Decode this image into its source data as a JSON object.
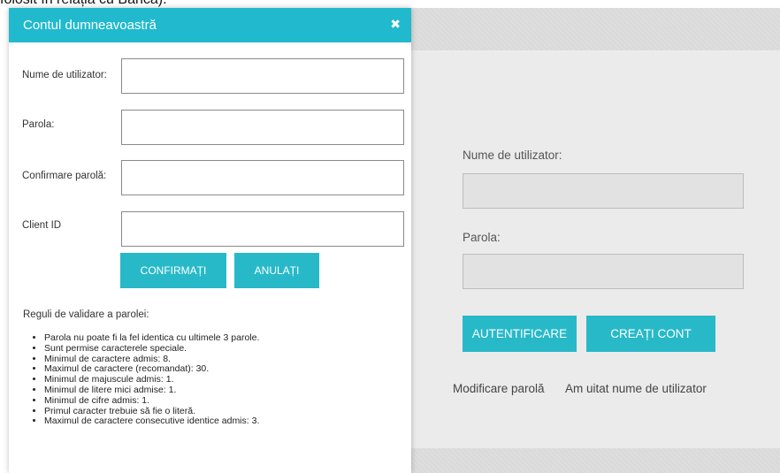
{
  "background_text": "folosit în relația cu Banca).",
  "modal": {
    "title": "Contul dumneavoastră",
    "close_symbol": "✖",
    "fields": [
      {
        "label": "Nume de utilizator:"
      },
      {
        "label": "Parola:"
      },
      {
        "label": "Confirmare parolă:"
      },
      {
        "label": "Client ID"
      }
    ],
    "confirm_button": "CONFIRMAȚI",
    "cancel_button": "ANULAȚI",
    "rules_title": "Reguli de validare a parolei:",
    "rules": [
      "Parola nu poate fi la fel identica cu ultimele 3 parole.",
      "Sunt permise caracterele speciale.",
      "Minimul de caractere admis: 8.",
      "Maximul de caractere (recomandat): 30.",
      "Minimul de majuscule admis: 1.",
      "Minimul de litere mici admise: 1.",
      "Minimul de cifre admis: 1.",
      "Primul caracter trebuie să fie o literă.",
      "Maximul de caractere consecutive identice admis: 3."
    ]
  },
  "login": {
    "username_label": "Nume de utilizator:",
    "password_label": "Parola:",
    "login_button": "AUTENTIFICARE",
    "create_account_button": "CREAȚI CONT",
    "change_password_link": "Modificare parolă",
    "forgot_username_link": "Am uitat nume de utilizator"
  },
  "colors": {
    "accent": "#20b9cd",
    "button": "#28b9c8",
    "background": "#ebebeb"
  }
}
